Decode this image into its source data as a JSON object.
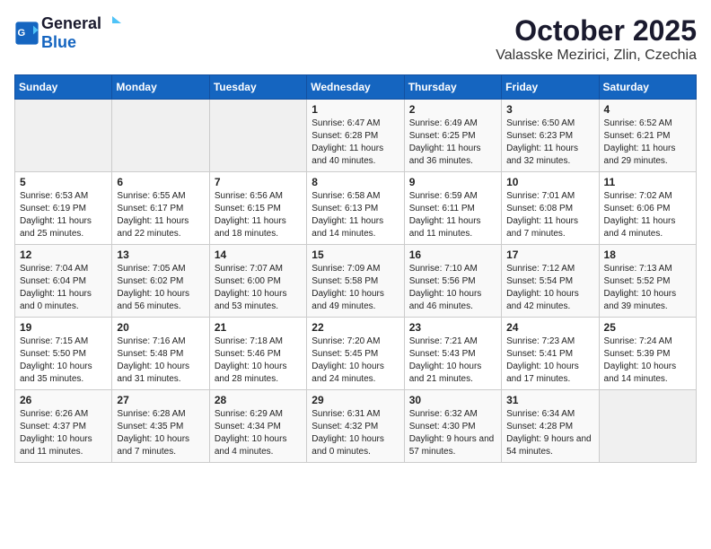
{
  "header": {
    "logo_line1": "General",
    "logo_line2": "Blue",
    "month": "October 2025",
    "location": "Valasske Mezirici, Zlin, Czechia"
  },
  "weekdays": [
    "Sunday",
    "Monday",
    "Tuesday",
    "Wednesday",
    "Thursday",
    "Friday",
    "Saturday"
  ],
  "weeks": [
    [
      {
        "day": "",
        "content": ""
      },
      {
        "day": "",
        "content": ""
      },
      {
        "day": "",
        "content": ""
      },
      {
        "day": "1",
        "content": "Sunrise: 6:47 AM\nSunset: 6:28 PM\nDaylight: 11 hours and 40 minutes."
      },
      {
        "day": "2",
        "content": "Sunrise: 6:49 AM\nSunset: 6:25 PM\nDaylight: 11 hours and 36 minutes."
      },
      {
        "day": "3",
        "content": "Sunrise: 6:50 AM\nSunset: 6:23 PM\nDaylight: 11 hours and 32 minutes."
      },
      {
        "day": "4",
        "content": "Sunrise: 6:52 AM\nSunset: 6:21 PM\nDaylight: 11 hours and 29 minutes."
      }
    ],
    [
      {
        "day": "5",
        "content": "Sunrise: 6:53 AM\nSunset: 6:19 PM\nDaylight: 11 hours and 25 minutes."
      },
      {
        "day": "6",
        "content": "Sunrise: 6:55 AM\nSunset: 6:17 PM\nDaylight: 11 hours and 22 minutes."
      },
      {
        "day": "7",
        "content": "Sunrise: 6:56 AM\nSunset: 6:15 PM\nDaylight: 11 hours and 18 minutes."
      },
      {
        "day": "8",
        "content": "Sunrise: 6:58 AM\nSunset: 6:13 PM\nDaylight: 11 hours and 14 minutes."
      },
      {
        "day": "9",
        "content": "Sunrise: 6:59 AM\nSunset: 6:11 PM\nDaylight: 11 hours and 11 minutes."
      },
      {
        "day": "10",
        "content": "Sunrise: 7:01 AM\nSunset: 6:08 PM\nDaylight: 11 hours and 7 minutes."
      },
      {
        "day": "11",
        "content": "Sunrise: 7:02 AM\nSunset: 6:06 PM\nDaylight: 11 hours and 4 minutes."
      }
    ],
    [
      {
        "day": "12",
        "content": "Sunrise: 7:04 AM\nSunset: 6:04 PM\nDaylight: 11 hours and 0 minutes."
      },
      {
        "day": "13",
        "content": "Sunrise: 7:05 AM\nSunset: 6:02 PM\nDaylight: 10 hours and 56 minutes."
      },
      {
        "day": "14",
        "content": "Sunrise: 7:07 AM\nSunset: 6:00 PM\nDaylight: 10 hours and 53 minutes."
      },
      {
        "day": "15",
        "content": "Sunrise: 7:09 AM\nSunset: 5:58 PM\nDaylight: 10 hours and 49 minutes."
      },
      {
        "day": "16",
        "content": "Sunrise: 7:10 AM\nSunset: 5:56 PM\nDaylight: 10 hours and 46 minutes."
      },
      {
        "day": "17",
        "content": "Sunrise: 7:12 AM\nSunset: 5:54 PM\nDaylight: 10 hours and 42 minutes."
      },
      {
        "day": "18",
        "content": "Sunrise: 7:13 AM\nSunset: 5:52 PM\nDaylight: 10 hours and 39 minutes."
      }
    ],
    [
      {
        "day": "19",
        "content": "Sunrise: 7:15 AM\nSunset: 5:50 PM\nDaylight: 10 hours and 35 minutes."
      },
      {
        "day": "20",
        "content": "Sunrise: 7:16 AM\nSunset: 5:48 PM\nDaylight: 10 hours and 31 minutes."
      },
      {
        "day": "21",
        "content": "Sunrise: 7:18 AM\nSunset: 5:46 PM\nDaylight: 10 hours and 28 minutes."
      },
      {
        "day": "22",
        "content": "Sunrise: 7:20 AM\nSunset: 5:45 PM\nDaylight: 10 hours and 24 minutes."
      },
      {
        "day": "23",
        "content": "Sunrise: 7:21 AM\nSunset: 5:43 PM\nDaylight: 10 hours and 21 minutes."
      },
      {
        "day": "24",
        "content": "Sunrise: 7:23 AM\nSunset: 5:41 PM\nDaylight: 10 hours and 17 minutes."
      },
      {
        "day": "25",
        "content": "Sunrise: 7:24 AM\nSunset: 5:39 PM\nDaylight: 10 hours and 14 minutes."
      }
    ],
    [
      {
        "day": "26",
        "content": "Sunrise: 6:26 AM\nSunset: 4:37 PM\nDaylight: 10 hours and 11 minutes."
      },
      {
        "day": "27",
        "content": "Sunrise: 6:28 AM\nSunset: 4:35 PM\nDaylight: 10 hours and 7 minutes."
      },
      {
        "day": "28",
        "content": "Sunrise: 6:29 AM\nSunset: 4:34 PM\nDaylight: 10 hours and 4 minutes."
      },
      {
        "day": "29",
        "content": "Sunrise: 6:31 AM\nSunset: 4:32 PM\nDaylight: 10 hours and 0 minutes."
      },
      {
        "day": "30",
        "content": "Sunrise: 6:32 AM\nSunset: 4:30 PM\nDaylight: 9 hours and 57 minutes."
      },
      {
        "day": "31",
        "content": "Sunrise: 6:34 AM\nSunset: 4:28 PM\nDaylight: 9 hours and 54 minutes."
      },
      {
        "day": "",
        "content": ""
      }
    ]
  ]
}
